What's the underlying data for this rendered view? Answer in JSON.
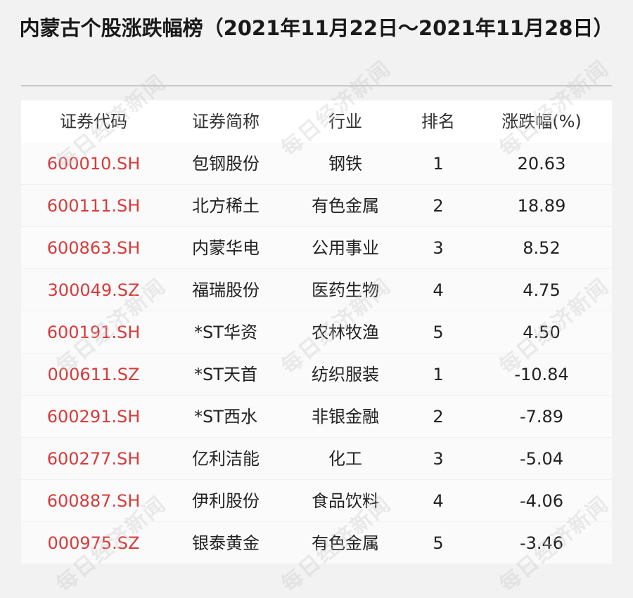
{
  "title": "内蒙古个股涨跌幅榜（2021年11月22日～2021年11月28日）",
  "watermark": "每日经济新闻",
  "columns": {
    "code": "证券代码",
    "name": "证券简称",
    "industry": "行业",
    "rank": "排名",
    "change": "涨跌幅(%)"
  },
  "rows": [
    {
      "code": "600010.SH",
      "name": "包钢股份",
      "industry": "钢铁",
      "rank": "1",
      "change": "20.63"
    },
    {
      "code": "600111.SH",
      "name": "北方稀土",
      "industry": "有色金属",
      "rank": "2",
      "change": "18.89"
    },
    {
      "code": "600863.SH",
      "name": "内蒙华电",
      "industry": "公用事业",
      "rank": "3",
      "change": "8.52"
    },
    {
      "code": "300049.SZ",
      "name": "福瑞股份",
      "industry": "医药生物",
      "rank": "4",
      "change": "4.75"
    },
    {
      "code": "600191.SH",
      "name": "*ST华资",
      "industry": "农林牧渔",
      "rank": "5",
      "change": "4.50"
    },
    {
      "code": "000611.SZ",
      "name": "*ST天首",
      "industry": "纺织服装",
      "rank": "1",
      "change": "-10.84"
    },
    {
      "code": "600291.SH",
      "name": "*ST西水",
      "industry": "非银金融",
      "rank": "2",
      "change": "-7.89"
    },
    {
      "code": "600277.SH",
      "name": "亿利洁能",
      "industry": "化工",
      "rank": "3",
      "change": "-5.04"
    },
    {
      "code": "600887.SH",
      "name": "伊利股份",
      "industry": "食品饮料",
      "rank": "4",
      "change": "-4.06"
    },
    {
      "code": "000975.SZ",
      "name": "银泰黄金",
      "industry": "有色金属",
      "rank": "5",
      "change": "-3.46"
    }
  ],
  "colors": {
    "code_text": "#d93a3a",
    "background": "#f2f2f2",
    "row_background": "#fbfbfb"
  }
}
